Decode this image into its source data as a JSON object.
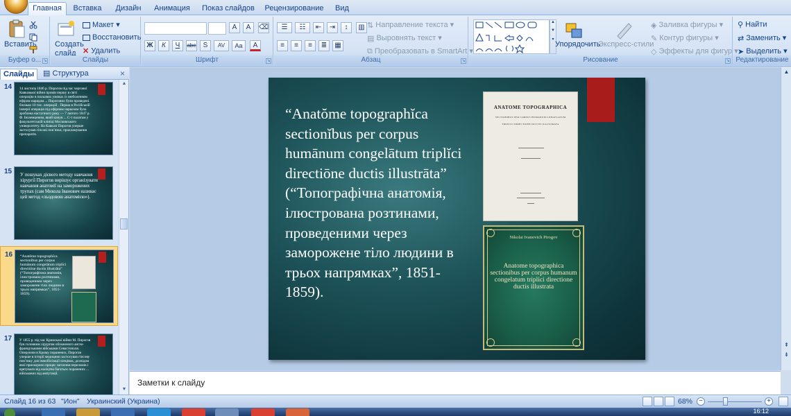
{
  "tabs": [
    "Главная",
    "Вставка",
    "Дизайн",
    "Анимация",
    "Показ слайдов",
    "Рецензирование",
    "Вид"
  ],
  "ribbon": {
    "clipboard": {
      "paste": "Вставить",
      "label": "Буфер о..."
    },
    "slides": {
      "create": "Создать",
      "create2": "слайд",
      "layout": "Макет",
      "reset": "Восстановить",
      "delete": "Удалить",
      "label": "Слайды"
    },
    "font": {
      "label": "Шрифт",
      "bold": "Ж",
      "italic": "К",
      "underline": "Ч",
      "strike": "abe",
      "shadow": "S",
      "spacing": "AV",
      "case": "Aa",
      "size_up": "A",
      "size_down": "A"
    },
    "paragraph": {
      "text_direction": "Направление текста",
      "align_text": "Выровнять текст",
      "convert_smartart": "Преобразовать в SmartArt",
      "label": "Абзац"
    },
    "drawing": {
      "arrange": "Упорядочить",
      "quick_styles": "Экспресс-стили",
      "shape_fill": "Заливка фигуры",
      "shape_outline": "Контур фигуры",
      "shape_effects": "Эффекты для фигур",
      "label": "Рисование"
    },
    "editing": {
      "find": "Найти",
      "replace": "Заменить",
      "select": "Выделить",
      "label": "Редактирование"
    }
  },
  "pane": {
    "tab_slides": "Слайды",
    "tab_outline": "Структура",
    "close": "×"
  },
  "thumbnails": [
    {
      "num": "14",
      "text": "14 листопа 1846 р. Пирогов під час чергової Кавказької війни провів першу в світі операцію в польових умовах із знеболенням ефіром нарядам ... Пирогових були проведені близько 10 тис. операцій . Перша в Російській імперії операція під ефірним наркозом була зроблена наступного року — 7 лютого 1847 р. Ф. Іноземцевим, який кинув ... С-т палатам у факультетській клініці Московського університету. На Кавказі Пирогов уперше застосував гіпсові пов’язки, прокламування препаратів."
    },
    {
      "num": "15",
      "text": "У пошуках дієвого методу навчання хірургії Пирогов вирішує організувати навчання анатомії на заморожених трупах (сам Микола Іванович називає цей метод «льодовою анатомією»)."
    },
    {
      "num": "16",
      "text": "“Anatŏme topographĭca sectionĭbus per corpus humānum congelātum triplĭci directiōne ductis illustrāta” (“Топографічна анатомія, ілюстрована розтинами, проведеними через заморожене тіло людини в трьох напрямках”, 1851-1859)."
    },
    {
      "num": "17",
      "text": "У 1855 р. під час Кримської війни М. Пирогов був головним хірургом обложеного англо-французькими військами Севастополя. Оперуючи в Криму поранених, Пирогов уперше в історії медицини застосував гіпсову пов’язку для іммобілізації кінцівок, досвідом якої прискорило процес загоєння переломів і врятувало від каліцтва багатьох поранених ... військових від ампутації."
    }
  ],
  "slide": {
    "text": "“Anatŏme topographĭca sectionĭbus per corpus humānum congelātum triplĭci directiōne ductis illustrāta” (“Топографічна анатомія, ілюстрована розтинами, проведеними через заморожене тіло людини в трьох напрямках”, 1851-1859).",
    "book1_title": "ANATOME TOPOGRAPHICA",
    "book1_sub": "SECTIONIBUS PER CORPUS HUMANUM CONGELATUM",
    "book1_sub2": "TRIPLICI DIRECTIONE DUCTIS ILLUSTRATA",
    "book2_author": "Nikolai Ivanovich Pirogov",
    "book2_title": "Anatome topographica sectionibus per corpus humanum congelatum triplici directione ductis illustrata"
  },
  "notes_placeholder": "Заметки к слайду",
  "status": {
    "slide": "Слайд 16 из 63",
    "theme": "\"Ион\"",
    "language": "Украинский (Украина)",
    "zoom": "68%"
  },
  "zoom_level": 0.68,
  "clock": "16:12",
  "colors": {
    "slide_bg": "#1d5359",
    "accent_red": "#a81c1c",
    "ribbon": "#d5e3f5"
  }
}
